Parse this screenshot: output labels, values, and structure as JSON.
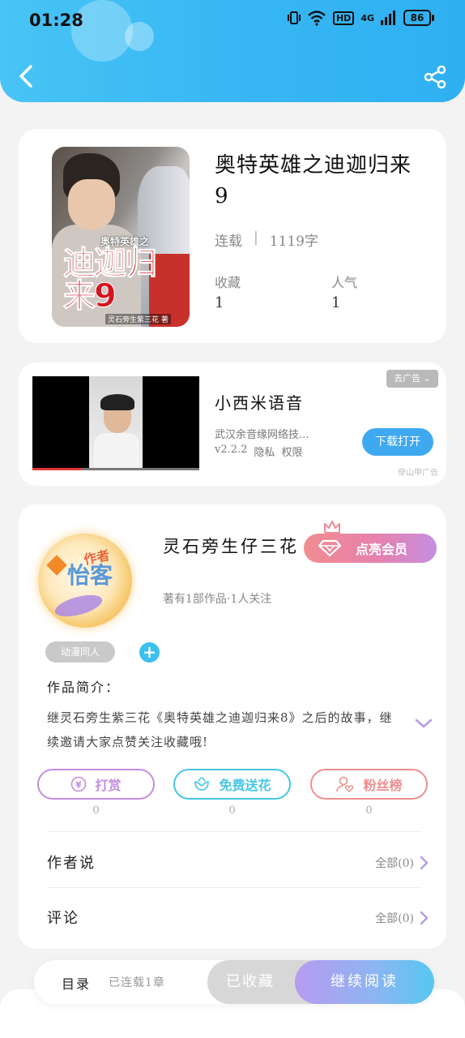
{
  "status_bar": {
    "time": "01:28",
    "network": "HD",
    "signal": "4G",
    "battery": "86"
  },
  "book": {
    "title": "奥特英雄之迪迦归来9",
    "status": "连载",
    "word_count": "1119字",
    "favorites_label": "收藏",
    "favorites_value": "1",
    "popularity_label": "人气",
    "popularity_value": "1",
    "cover": {
      "small_title": "奥特英雄之",
      "big_title": "迪迦归来9",
      "footer": "灵石旁生紫三花 著"
    }
  },
  "ad": {
    "tag": "去广告",
    "title": "小西米语音",
    "description": "武汉余音缘网络技...",
    "version": "v2.2.2",
    "privacy": "隐私",
    "permissions": "权限",
    "download_button": "下载打开",
    "source": "穿山甲广告"
  },
  "author": {
    "name": "灵石旁生仔三花",
    "info": "著有1部作品·1人关注",
    "badge_top": "作者",
    "badge_main": "怡客",
    "vip_button": "点亮会员",
    "tag": "动漫同人",
    "add_tag": "+"
  },
  "intro": {
    "label": "作品简介：",
    "text": "继灵石旁生紫三花《奥特英雄之迪迦归来8》之后的故事，继续邀请大家点赞关注收藏哦!"
  },
  "actions": [
    {
      "label": "打赏",
      "count": "0",
      "color": "#c48de0"
    },
    {
      "label": "免费送花",
      "count": "0",
      "color": "#47c6e4"
    },
    {
      "label": "粉丝榜",
      "count": "0",
      "color": "#ee8f8f"
    }
  ],
  "rows": {
    "author_says": {
      "label": "作者说",
      "right": "全部(0)"
    },
    "comments": {
      "label": "评论",
      "right": "全部(0)"
    }
  },
  "bottom": {
    "toc": "目录",
    "toc_status": "已连载1章",
    "collected": "已收藏",
    "continue": "继续阅读"
  },
  "colors": {
    "header": "#37b7f3",
    "accent_purple": "#b59ce8",
    "download_blue": "#3fa9f0"
  }
}
